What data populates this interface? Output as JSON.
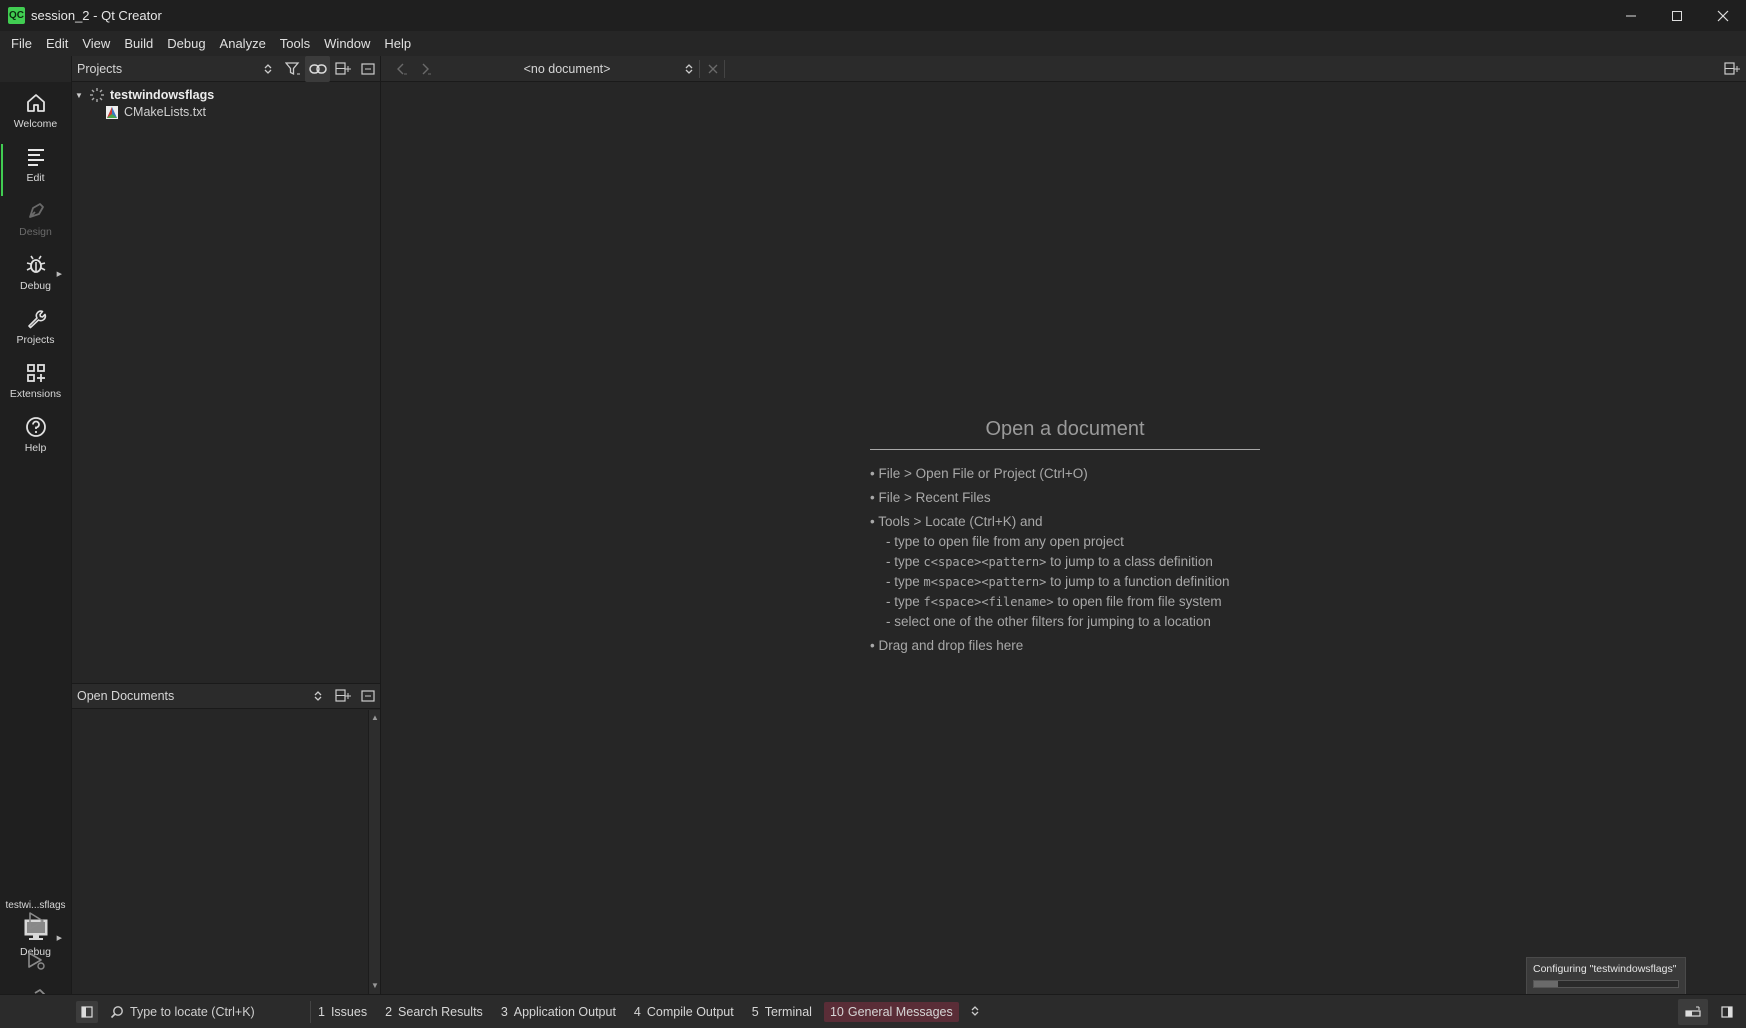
{
  "window": {
    "title": "session_2 - Qt Creator",
    "logo_text": "QC"
  },
  "menu": [
    "File",
    "Edit",
    "View",
    "Build",
    "Debug",
    "Analyze",
    "Tools",
    "Window",
    "Help"
  ],
  "modes": [
    {
      "label": "Welcome",
      "icon": "home-icon",
      "enabled": true
    },
    {
      "label": "Edit",
      "icon": "edit-icon",
      "enabled": true,
      "active": true
    },
    {
      "label": "Design",
      "icon": "design-icon",
      "enabled": false
    },
    {
      "label": "Debug",
      "icon": "bug-icon",
      "enabled": true
    },
    {
      "label": "Projects",
      "icon": "wrench-icon",
      "enabled": true
    },
    {
      "label": "Extensions",
      "icon": "extensions-icon",
      "enabled": true
    },
    {
      "label": "Help",
      "icon": "help-icon",
      "enabled": true
    }
  ],
  "kit": {
    "project": "testwi...sflags",
    "build_config": "Debug"
  },
  "projects_pane": {
    "title": "Projects",
    "tree": [
      {
        "label": "testwindowsflags",
        "bold": true
      },
      {
        "label": "CMakeLists.txt"
      }
    ]
  },
  "open_documents": {
    "title": "Open Documents"
  },
  "editor": {
    "document_combo": "<no document>",
    "welcome": {
      "title": "Open a document",
      "lines": [
        "• File > Open File or Project (Ctrl+O)",
        "• File > Recent Files",
        "• Tools > Locate (Ctrl+K) and"
      ],
      "sublines": [
        {
          "pre": "- type to open file from any open project",
          "code": "",
          "post": ""
        },
        {
          "pre": "- type ",
          "code": "c<space><pattern>",
          "post": " to jump to a class definition"
        },
        {
          "pre": "- type ",
          "code": "m<space><pattern>",
          "post": " to jump to a function definition"
        },
        {
          "pre": "- type ",
          "code": "f<space><filename>",
          "post": " to open file from file system"
        },
        {
          "pre": "- select one of the other filters for jumping to a location",
          "code": "",
          "post": ""
        }
      ],
      "last_line": "• Drag and drop files here"
    }
  },
  "progress": {
    "label": "Configuring \"testwindowsflags\"",
    "fraction": 0.17
  },
  "statusbar": {
    "locator_placeholder": "Type to locate (Ctrl+K)",
    "output_tabs": [
      {
        "num": "1",
        "label": "Issues"
      },
      {
        "num": "2",
        "label": "Search Results"
      },
      {
        "num": "3",
        "label": "Application Output"
      },
      {
        "num": "4",
        "label": "Compile Output"
      },
      {
        "num": "5",
        "label": "Terminal"
      },
      {
        "num": "10",
        "label": "General Messages",
        "highlight": true
      }
    ]
  },
  "colors": {
    "accent": "#41cd52",
    "highlight_tab": "#5a2d37",
    "background": "#262626"
  }
}
